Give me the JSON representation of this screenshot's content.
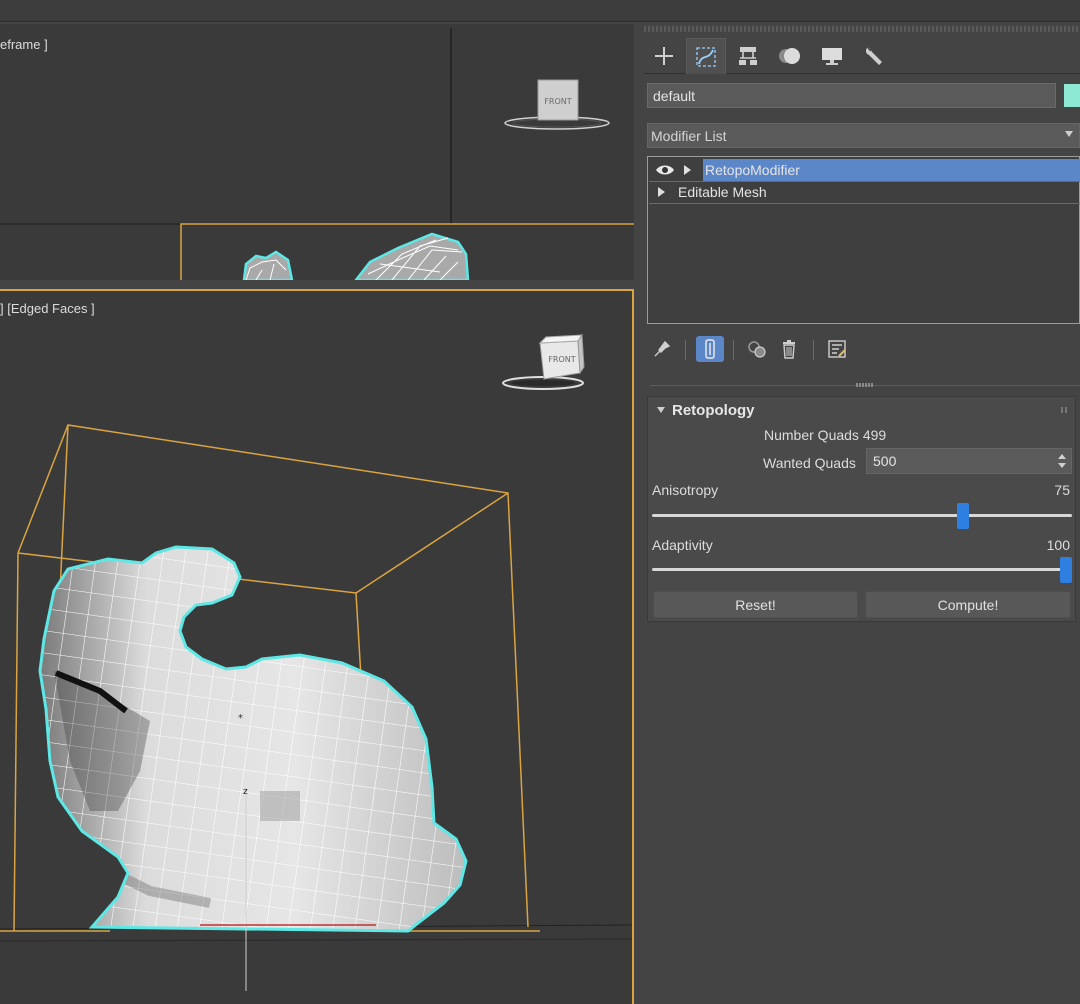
{
  "viewports": {
    "top": {
      "label": "eframe ]"
    },
    "perspective": {
      "label": "] [Edged Faces ]"
    },
    "viewcube_label": "FRONT"
  },
  "panel": {
    "tabs": [
      {
        "name": "create-tab",
        "icon": "plus-icon"
      },
      {
        "name": "modify-tab",
        "icon": "modify-curve-icon",
        "active": true
      },
      {
        "name": "hierarchy-tab",
        "icon": "hierarchy-icon"
      },
      {
        "name": "motion-tab",
        "icon": "motion-icon"
      },
      {
        "name": "display-tab",
        "icon": "monitor-icon"
      },
      {
        "name": "utilities-tab",
        "icon": "wrench-icon"
      }
    ],
    "object_name": "default",
    "object_color": "#8ee8d4",
    "modifier_list_label": "Modifier List",
    "stack": [
      {
        "label": "RetopoModifier",
        "selected": true,
        "visible_icon": "eye-icon"
      },
      {
        "label": "Editable Mesh",
        "selected": false
      }
    ],
    "stack_tools": [
      "pin-icon",
      "show-end-result-icon",
      "make-unique-icon",
      "remove-modifier-icon",
      "configure-icon"
    ],
    "rollout": {
      "title": "Retopology",
      "number_quads_label": "Number Quads 499",
      "wanted_quads_label": "Wanted Quads",
      "wanted_quads_value": "500",
      "anisotropy_label": "Anisotropy",
      "anisotropy_value": "75",
      "anisotropy_fraction": 0.74,
      "adaptivity_label": "Adaptivity",
      "adaptivity_value": "100",
      "adaptivity_fraction": 0.985,
      "reset_label": "Reset!",
      "compute_label": "Compute!"
    }
  },
  "colors": {
    "selection": "#5b87c8",
    "slider_thumb": "#2f7fe0",
    "viewport_active_border": "#d9a441",
    "mesh_outline": "#5de8e6"
  }
}
